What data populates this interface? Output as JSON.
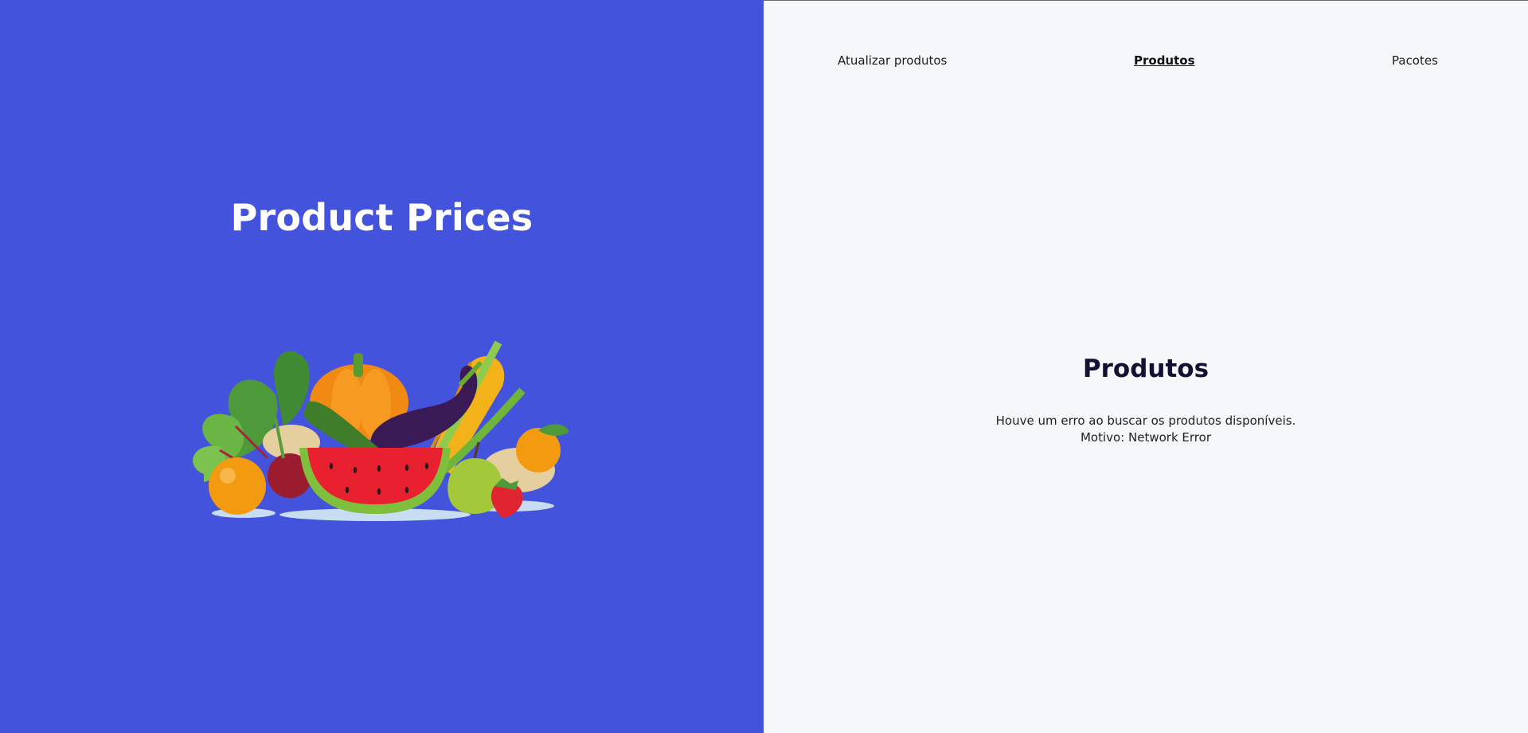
{
  "brand": {
    "title": "Product Prices",
    "illustration": "fruits-and-vegetables-illustration"
  },
  "nav": {
    "items": [
      {
        "label": "Atualizar produtos",
        "active": false
      },
      {
        "label": "Produtos",
        "active": true
      },
      {
        "label": "Pacotes",
        "active": false
      }
    ]
  },
  "main": {
    "title": "Produtos",
    "error_line1": "Houve um erro ao buscar os produtos disponíveis.",
    "error_line2": "Motivo: Network Error"
  },
  "colors": {
    "left_panel": "#4453dc",
    "right_panel": "#f5f7fa",
    "title_text": "#ffffff",
    "heading_text": "#141033"
  }
}
